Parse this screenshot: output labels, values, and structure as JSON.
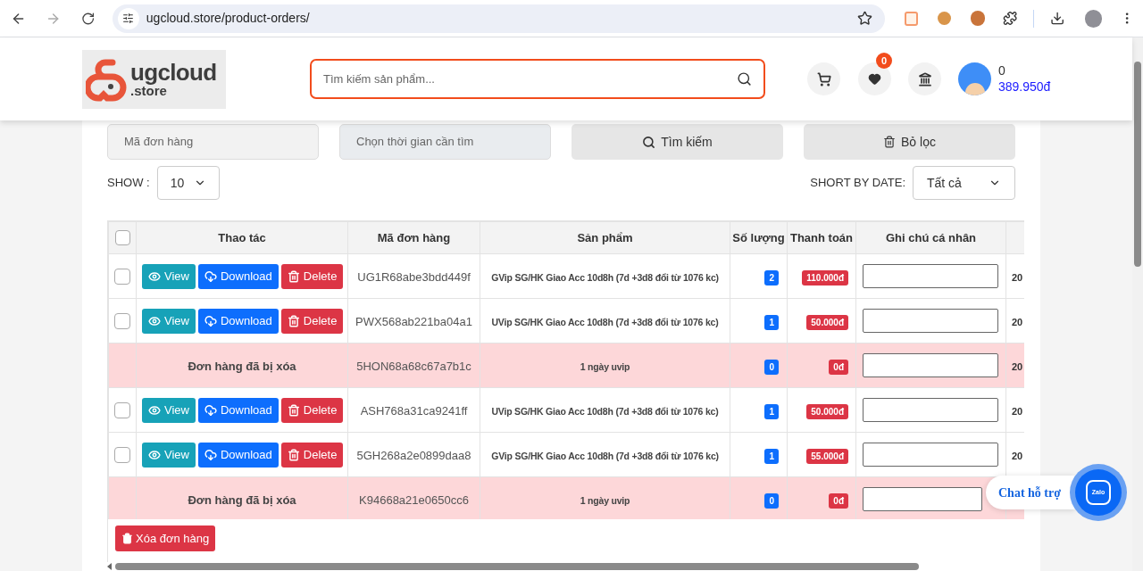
{
  "browser": {
    "url": "ugcloud.store/product-orders/"
  },
  "header": {
    "logo": {
      "main": "ugcloud",
      "sub": ".store"
    },
    "search": {
      "placeholder": "Tìm kiếm sản phẩm..."
    },
    "wishlist_badge": "0",
    "account": {
      "count": "0",
      "balance": "389.950đ"
    }
  },
  "filters": {
    "order_code": {
      "placeholder": "Mã đơn hàng"
    },
    "time": {
      "placeholder": "Chọn thời gian cần tìm"
    },
    "search_button": "Tìm kiếm",
    "filter_button": "Bỏ lọc"
  },
  "show": {
    "label": "SHOW :",
    "value": "10"
  },
  "sort": {
    "label": "SHORT BY DATE:",
    "value": "Tất cả"
  },
  "table": {
    "select_all": {
      "checked": false
    },
    "columns": [
      "Thao tác",
      "Mã đơn hàng",
      "Sản phẩm",
      "Số lượng",
      "Thanh toán",
      "Ghi chú cá nhân"
    ],
    "rows": [
      {
        "kind": "order",
        "checked": false,
        "actions": [
          "View",
          "Download",
          "Delete"
        ],
        "code": "UG1R68abe3bdd449f",
        "product": "GVip SG/HK Giao Acc 10d8h (7d +3d8 đổi từ 1076 kc)",
        "quantity": "2",
        "payment": "110.000đ",
        "column_7": "20"
      },
      {
        "kind": "order",
        "checked": false,
        "actions": [
          "View",
          "Download",
          "Delete"
        ],
        "code": "PWX568ab221ba04a1",
        "product": "UVip SG/HK Giao Acc 10d8h (7d +3d8 đổi từ 1076 kc)",
        "quantity": "1",
        "payment": "50.000đ",
        "column_7": "20"
      },
      {
        "kind": "deleted",
        "status": "Đơn hàng đã bị xóa",
        "code": "5HON68a68c67a7b1c",
        "product": "1 ngày uvip",
        "quantity": "0",
        "payment": "0đ",
        "column_7": "20"
      },
      {
        "kind": "order",
        "checked": false,
        "actions": [
          "View",
          "Download",
          "Delete"
        ],
        "code": "ASH768a31ca9241ff",
        "product": "UVip SG/HK Giao Acc 10d8h (7d +3d8 đổi từ 1076 kc)",
        "quantity": "1",
        "payment": "50.000đ",
        "column_7": "20"
      },
      {
        "kind": "order",
        "checked": false,
        "actions": [
          "View",
          "Download",
          "Delete"
        ],
        "code": "5GH268a2e0899daa8",
        "product": "GVip SG/HK Giao Acc 10d8h (7d +3d8 đổi từ 1076 kc)",
        "quantity": "1",
        "payment": "55.000đ",
        "column_7": "20"
      },
      {
        "kind": "deleted",
        "status": "Đơn hàng đã bị xóa",
        "code": "K94668a21e0650cc6",
        "product": "1 ngày uvip",
        "quantity": "0",
        "payment": "0đ"
      }
    ],
    "delete_button": "Xóa đơn hàng"
  },
  "chat": {
    "label": "Chat hỗ trợ",
    "icon_text": "Zalo"
  }
}
